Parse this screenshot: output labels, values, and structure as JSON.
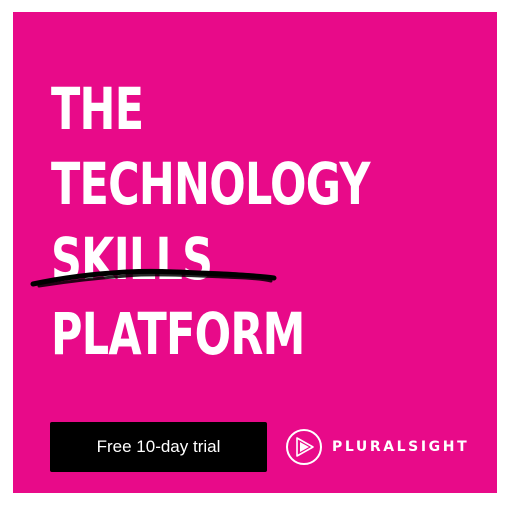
{
  "ad": {
    "background_color": "#e80a89",
    "headline": {
      "line1": "THE",
      "line2": "TECHNOLOGY",
      "line3": "SKILLS",
      "line4": "PLATFORM"
    },
    "cta": {
      "label": "Free 10-day trial",
      "background_color": "#000000",
      "text_color": "#ffffff"
    },
    "brand": {
      "name": "PLURALSIGHT",
      "icon": "pluralsight-play-logo-icon"
    }
  }
}
